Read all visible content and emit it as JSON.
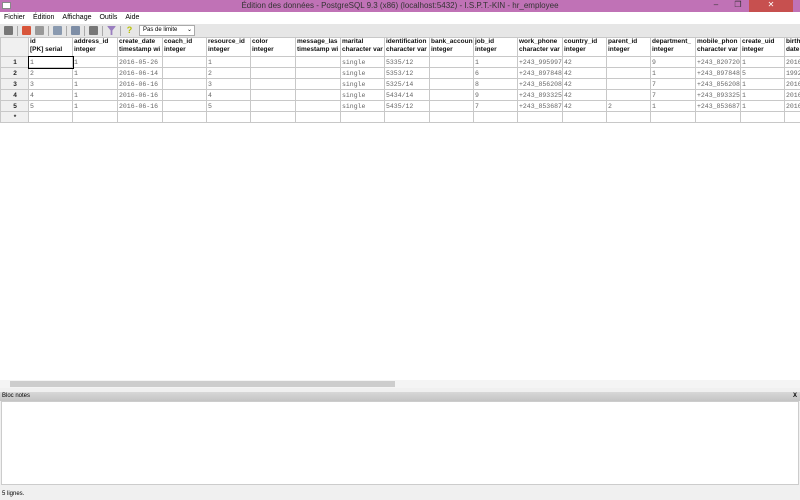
{
  "window": {
    "title": "Édition des données - PostgreSQL 9.3 (x86) (localhost:5432) - I.S.P.T.-KIN - hr_employee",
    "minimize": "–",
    "maximize": "❐",
    "close": "✕"
  },
  "menu": [
    "Fichier",
    "Édition",
    "Affichage",
    "Outils",
    "Aide"
  ],
  "toolbar": {
    "limit": "Pas de limite",
    "icons": [
      "save-icon",
      "refresh-icon",
      "undo-icon",
      "copy-icon",
      "paste-icon",
      "delete-icon",
      "filter-icon",
      "help-icon"
    ]
  },
  "columns": [
    {
      "name": "id",
      "type": "[PK] serial"
    },
    {
      "name": "address_id",
      "type": "integer"
    },
    {
      "name": "create_date",
      "type": "timestamp wi"
    },
    {
      "name": "coach_id",
      "type": "integer"
    },
    {
      "name": "resource_id",
      "type": "integer"
    },
    {
      "name": "color",
      "type": "integer"
    },
    {
      "name": "message_las",
      "type": "timestamp wi"
    },
    {
      "name": "marital",
      "type": "character var"
    },
    {
      "name": "identification",
      "type": "character var"
    },
    {
      "name": "bank_accoun",
      "type": "integer"
    },
    {
      "name": "job_id",
      "type": "integer"
    },
    {
      "name": "work_phone",
      "type": "character var"
    },
    {
      "name": "country_id",
      "type": "integer"
    },
    {
      "name": "parent_id",
      "type": "integer"
    },
    {
      "name": "department_",
      "type": "integer"
    },
    {
      "name": "mobile_phon",
      "type": "character var"
    },
    {
      "name": "create_uid",
      "type": "integer"
    },
    {
      "name": "birth",
      "type": "date"
    }
  ],
  "rows": [
    {
      "n": "1",
      "cells": [
        "1",
        "1",
        "2016-05-26",
        "",
        "1",
        "",
        "",
        "single",
        "5335/12",
        "",
        "1",
        "+243_995997",
        "42",
        "",
        "9",
        "+243_820720",
        "1",
        "2016"
      ]
    },
    {
      "n": "2",
      "cells": [
        "2",
        "1",
        "2016-06-14",
        "",
        "2",
        "",
        "",
        "single",
        "5353/12",
        "",
        "6",
        "+243_897848",
        "42",
        "",
        "1",
        "+243_897848",
        "5",
        "1992"
      ]
    },
    {
      "n": "3",
      "cells": [
        "3",
        "1",
        "2016-06-16",
        "",
        "3",
        "",
        "",
        "single",
        "5325/14",
        "",
        "8",
        "+243_856208",
        "42",
        "",
        "7",
        "+243_856208",
        "1",
        "2016"
      ]
    },
    {
      "n": "4",
      "cells": [
        "4",
        "1",
        "2016-06-16",
        "",
        "4",
        "",
        "",
        "single",
        "5434/14",
        "",
        "9",
        "+243_893325",
        "42",
        "",
        "7",
        "+243_893325",
        "1",
        "2016"
      ]
    },
    {
      "n": "5",
      "cells": [
        "5",
        "1",
        "2016-06-16",
        "",
        "5",
        "",
        "",
        "single",
        "5435/12",
        "",
        "7",
        "+243_853687",
        "42",
        "2",
        "1",
        "+243_853687",
        "1",
        "2016"
      ]
    }
  ],
  "new_row_marker": "*",
  "notes": {
    "title": "Bloc notes",
    "close": "X"
  },
  "status": "5 lignes."
}
